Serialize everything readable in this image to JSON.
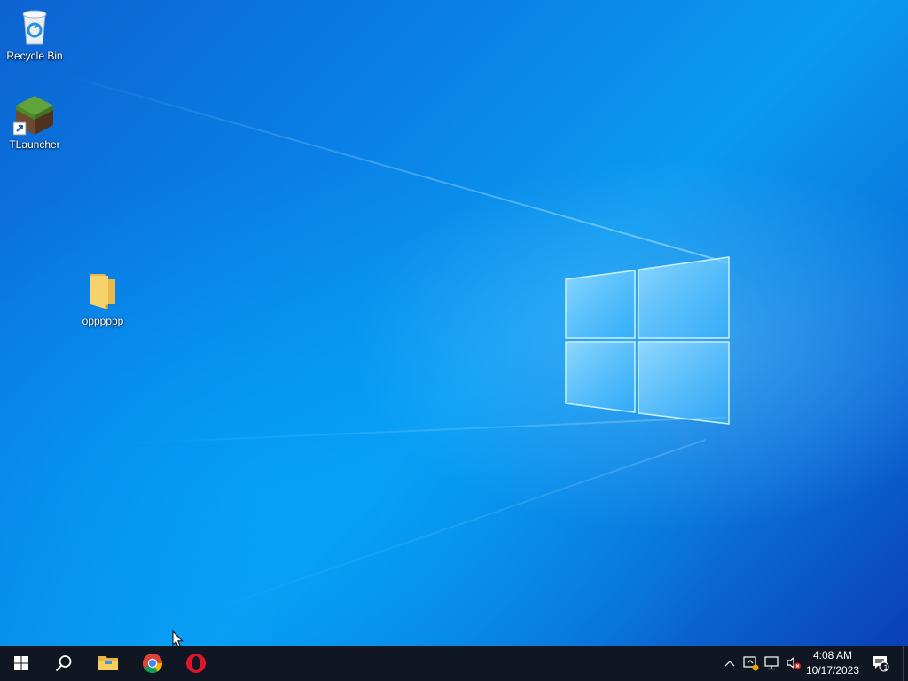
{
  "desktop": {
    "icons": [
      {
        "label": "Recycle Bin",
        "icon": "recycle-bin-icon"
      },
      {
        "label": "TLauncher",
        "icon": "tlauncher-icon"
      },
      {
        "label": "opppppp",
        "icon": "folder-icon"
      }
    ]
  },
  "taskbar": {
    "start": {
      "icon": "windows-start-icon"
    },
    "search": {
      "icon": "search-icon"
    },
    "pinned": [
      {
        "name": "File Explorer",
        "icon": "file-explorer-icon"
      },
      {
        "name": "Google Chrome",
        "icon": "chrome-icon"
      },
      {
        "name": "Opera",
        "icon": "opera-icon"
      }
    ],
    "tray": {
      "icons": [
        "chevron-up-icon",
        "security-warning-icon",
        "network-icon",
        "volume-muted-icon"
      ],
      "time": "4:08 AM",
      "date": "10/17/2023",
      "notifications_count": "1"
    }
  },
  "colors": {
    "taskbar_bg": "#101723",
    "desktop_accent": "#0a7fe6",
    "opera_red": "#e0152b"
  }
}
